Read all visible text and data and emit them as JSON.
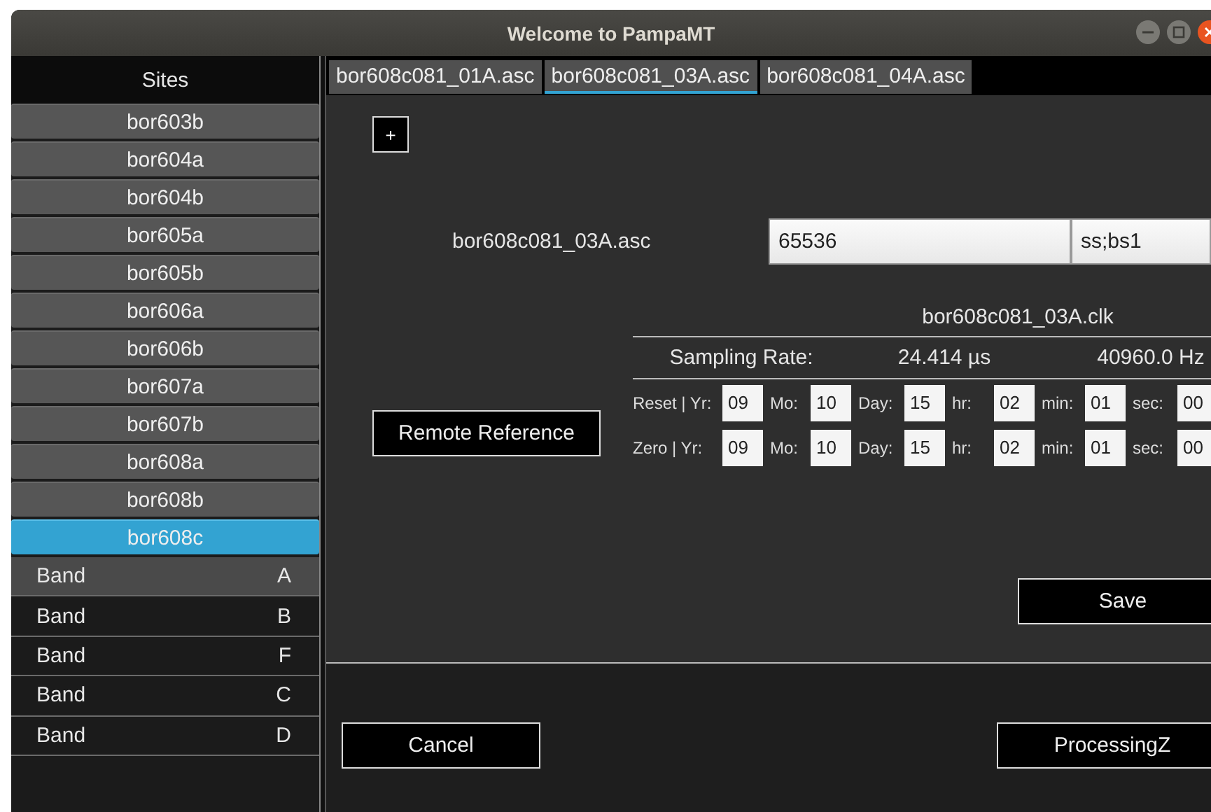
{
  "window": {
    "title": "Welcome to PampaMT"
  },
  "sidebar": {
    "heading": "Sites",
    "sites": [
      {
        "label": "bor603b",
        "selected": false
      },
      {
        "label": "bor604a",
        "selected": false
      },
      {
        "label": "bor604b",
        "selected": false
      },
      {
        "label": "bor605a",
        "selected": false
      },
      {
        "label": "bor605b",
        "selected": false
      },
      {
        "label": "bor606a",
        "selected": false
      },
      {
        "label": "bor606b",
        "selected": false
      },
      {
        "label": "bor607a",
        "selected": false
      },
      {
        "label": "bor607b",
        "selected": false
      },
      {
        "label": "bor608a",
        "selected": false
      },
      {
        "label": "bor608b",
        "selected": false
      },
      {
        "label": "bor608c",
        "selected": true
      }
    ],
    "bands": [
      {
        "label": "Band",
        "letter": "A",
        "selected": true
      },
      {
        "label": "Band",
        "letter": "B",
        "selected": false
      },
      {
        "label": "Band",
        "letter": "F",
        "selected": false
      },
      {
        "label": "Band",
        "letter": "C",
        "selected": false
      },
      {
        "label": "Band",
        "letter": "D",
        "selected": false
      }
    ]
  },
  "tabs": [
    {
      "label": "bor608c081_01A.asc",
      "selected": false
    },
    {
      "label": "bor608c081_03A.asc",
      "selected": true
    },
    {
      "label": "bor608c081_04A.asc",
      "selected": false
    }
  ],
  "add_button": "+",
  "file_label": "bor608c081_03A.asc",
  "fields": [
    {
      "value": "65536"
    },
    {
      "value": "ss;bs1"
    }
  ],
  "clock_file": "bor608c081_03A.clk",
  "sampling": {
    "label": "Sampling Rate:",
    "period": "24.414 µs",
    "frequency": "40960.0 Hz"
  },
  "time_rows": [
    {
      "label": "Reset | Yr:",
      "parts": [
        {
          "value": "09"
        },
        {
          "label": "Mo:",
          "value": "10"
        },
        {
          "label": "Day:",
          "value": "15"
        },
        {
          "label": "hr:",
          "value": "02"
        },
        {
          "label": "min:",
          "value": "01"
        },
        {
          "label": "sec:",
          "value": "00"
        }
      ]
    },
    {
      "label": "Zero  |  Yr:",
      "parts": [
        {
          "value": "09"
        },
        {
          "label": "Mo:",
          "value": "10"
        },
        {
          "label": "Day:",
          "value": "15"
        },
        {
          "label": "hr:",
          "value": "02"
        },
        {
          "label": "min:",
          "value": "01"
        },
        {
          "label": "sec:",
          "value": "00"
        }
      ]
    }
  ],
  "buttons": {
    "remote": "Remote Reference",
    "save": "Save",
    "cancel": "Cancel",
    "process": "ProcessingZ"
  }
}
